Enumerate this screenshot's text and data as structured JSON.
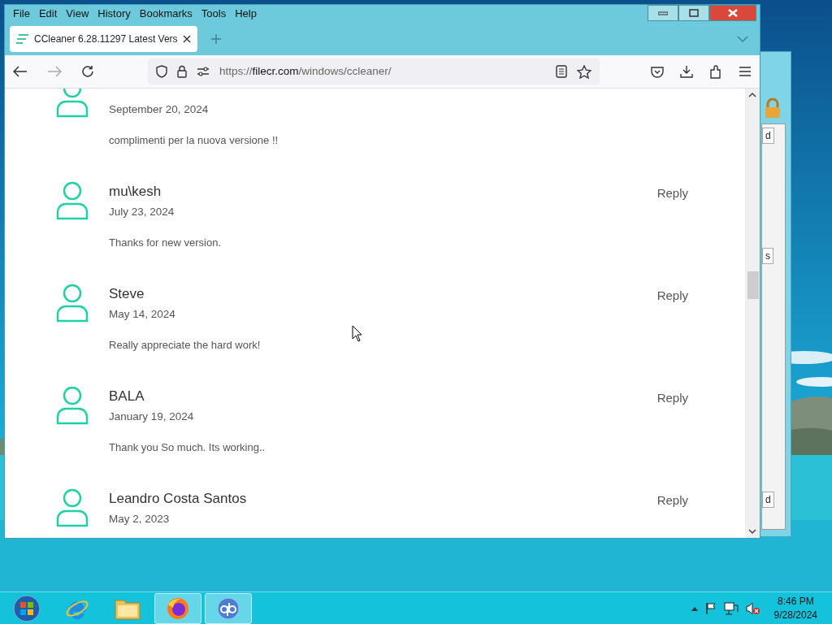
{
  "menu": [
    "File",
    "Edit",
    "View",
    "History",
    "Bookmarks",
    "Tools",
    "Help"
  ],
  "tab": {
    "title": "CCleaner 6.28.11297 Latest Vers",
    "selected": true
  },
  "url": {
    "scheme": "https://",
    "host": "filecr.com",
    "path": "/windows/ccleaner/"
  },
  "comments": [
    {
      "date": "September 20, 2024",
      "text": "complimenti per la nuova versione !!"
    },
    {
      "name": "mu\\kesh",
      "reply": "Reply",
      "date": "July 23, 2024",
      "text": "Thanks for new version."
    },
    {
      "name": "Steve",
      "reply": "Reply",
      "date": "May 14, 2024",
      "text": "Really appreciate the hard work!"
    },
    {
      "name": "BALA",
      "reply": "Reply",
      "date": "January 19, 2024",
      "text": "Thank you So much. Its working.."
    },
    {
      "name": "Leandro Costa Santos",
      "reply": "Reply",
      "date": "May 2, 2023"
    }
  ],
  "background_window": {
    "fragments": [
      "d",
      "s",
      "d"
    ]
  },
  "taskbar": {
    "apps": [
      {
        "kind": "ie",
        "selected": false
      },
      {
        "kind": "folder",
        "selected": false
      },
      {
        "kind": "firefox",
        "selected": true
      },
      {
        "kind": "qb",
        "selected": true
      }
    ]
  },
  "clock": {
    "time": "8:46 PM",
    "date": "9/28/2024"
  }
}
